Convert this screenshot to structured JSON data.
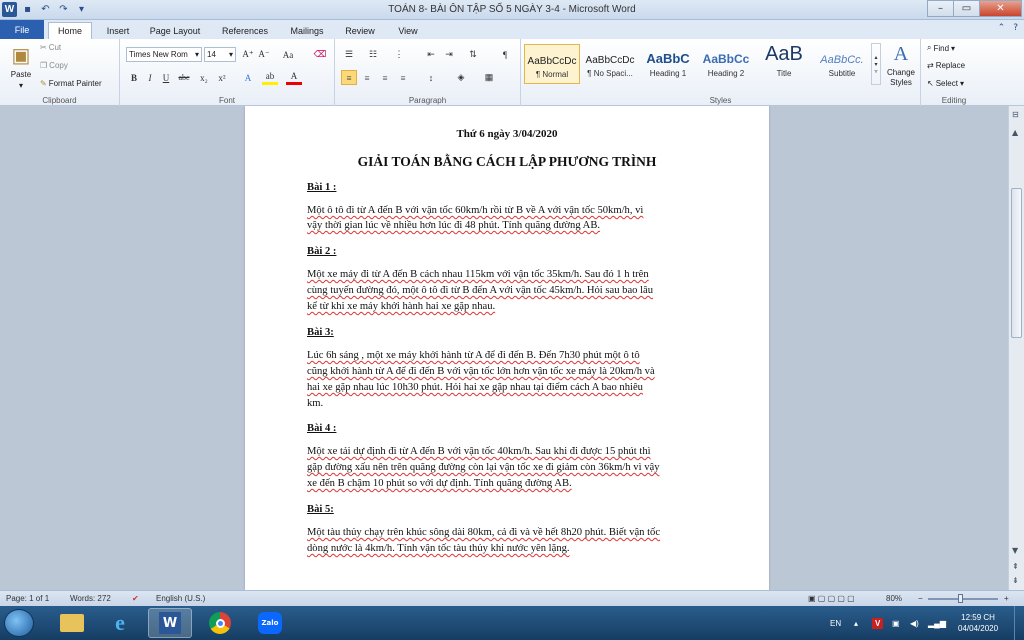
{
  "window": {
    "title": "TOÁN 8- BÀI ÔN TẬP SỐ 5 NGÀY 3-4  -  Microsoft Word",
    "app_letter": "W"
  },
  "tabs": [
    {
      "label": "File",
      "active": false
    },
    {
      "label": "Home",
      "active": true
    },
    {
      "label": "Insert",
      "active": false
    },
    {
      "label": "Page Layout",
      "active": false
    },
    {
      "label": "References",
      "active": false
    },
    {
      "label": "Mailings",
      "active": false
    },
    {
      "label": "Review",
      "active": false
    },
    {
      "label": "View",
      "active": false
    }
  ],
  "ribbon": {
    "clipboard": {
      "label": "Clipboard",
      "paste": "Paste",
      "cut": "Cut",
      "copy": "Copy",
      "format_painter": "Format Painter"
    },
    "font": {
      "label": "Font",
      "font_name": "Times New Rom",
      "font_size": "14"
    },
    "paragraph": {
      "label": "Paragraph"
    },
    "styles": {
      "label": "Styles",
      "items": [
        {
          "preview": "AaBbCcDc",
          "name": "¶ Normal"
        },
        {
          "preview": "AaBbCcDc",
          "name": "¶ No Spaci..."
        },
        {
          "preview": "AaBbC",
          "name": "Heading 1"
        },
        {
          "preview": "AaBbCc",
          "name": "Heading 2"
        },
        {
          "preview": "AaB",
          "name": "Title"
        },
        {
          "preview": "AaBbCc.",
          "name": "Subtitle"
        }
      ],
      "change_styles": "Change Styles"
    },
    "editing": {
      "label": "Editing",
      "find": "Find",
      "replace": "Replace",
      "select": "Select"
    }
  },
  "document": {
    "date_line": "Thứ 6 ngày 3/04/2020",
    "heading": "GIẢI TOÁN BẰNG CÁCH LẬP PHƯƠNG TRÌNH",
    "problems": [
      {
        "title": "Bài 1 :",
        "lines": [
          " Một ô tô đi từ A đến B với vận tốc 60km/h rồi từ  B về A với vận tốc 50km/h, vì",
          "vậy thời gian lúc về nhiều hơn lúc đi 48 phút. Tính quãng đường AB."
        ]
      },
      {
        "title": "Bài 2 :",
        "lines": [
          "Một xe máy đi từ A đến B cách nhau 115km với vận tốc 35km/h.  Sau đó 1 h trên",
          "cùng tuyến đường đó, một ô tô đi từ B đến A với vận tốc 45km/h. Hỏi sau bao lâu",
          "kể từ khi xe máy khởi hành hai xe gặp nhau."
        ]
      },
      {
        "title": "Bài 3:",
        "lines": [
          "Lúc 6h sáng , một xe máy khởi hành từ A để đi đến B. Đến 7h30 phút một ô tô",
          "cũng khởi hành từ A để đi đến B với vận tốc lớn hơn vận tốc xe máy là 20km/h và",
          "hai xe gặp nhau lúc 10h30 phút. Hỏi hai xe gặp nhau tại điểm cách A bao nhiêu",
          "km."
        ]
      },
      {
        "title": "Bài 4 :",
        "lines": [
          "Một xe tải dự định đi từ A đến B với vận tốc 40km/h. Sau khi đi được 15 phút thì",
          "gặp đường xấu nên trên quãng đường còn lại vận tốc xe đi giảm còn 36km/h vì vậy",
          "xe đến B chậm 10 phút so với dự định. Tính quãng đường AB."
        ]
      },
      {
        "title": "Bài 5:",
        "lines": [
          "Một tàu thủy chạy trên khúc sông dài 80km, cả đi và về hết 8h20 phút. Biết vận tốc",
          "dòng nước là 4km/h. Tính vận tốc tàu thủy khi nước yên lặng."
        ]
      }
    ]
  },
  "status": {
    "page": "Page: 1 of 1",
    "words": "Words: 272",
    "language": "English (U.S.)",
    "zoom": "80%",
    "zoom_value": 80
  },
  "taskbar": {
    "lang": "EN",
    "time": "12:59 CH",
    "date": "04/04/2020",
    "zalo": "Zalo"
  }
}
